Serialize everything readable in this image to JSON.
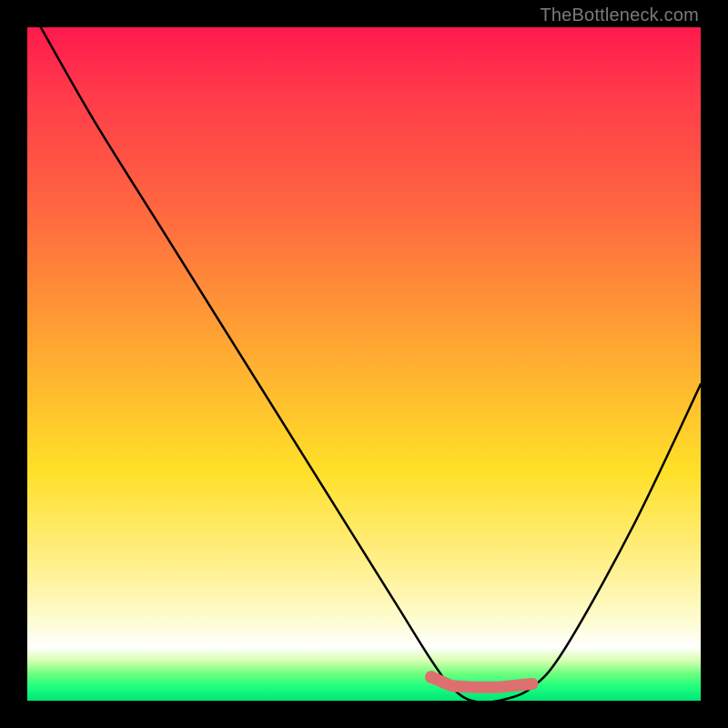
{
  "watermark": "TheBottleneck.com",
  "chart_data": {
    "type": "line",
    "title": "",
    "xlabel": "",
    "ylabel": "",
    "xlim": [
      0,
      100
    ],
    "ylim": [
      0,
      100
    ],
    "grid": false,
    "legend": false,
    "series": [
      {
        "name": "bottleneck-curve",
        "color": "#000000",
        "x": [
          2,
          10,
          20,
          30,
          40,
          50,
          55,
          60,
          63,
          66,
          70,
          75,
          80,
          90,
          100
        ],
        "y": [
          100,
          86,
          70,
          54,
          38,
          22,
          14,
          6,
          2,
          0,
          0,
          2,
          8,
          26,
          47
        ]
      }
    ],
    "annotations": [
      {
        "name": "optimal-marker",
        "type": "marker-segment",
        "color": "#e07070",
        "x": [
          60,
          63,
          66,
          70,
          75
        ],
        "y": [
          3.5,
          2.2,
          2.0,
          2.0,
          2.5
        ]
      }
    ]
  }
}
